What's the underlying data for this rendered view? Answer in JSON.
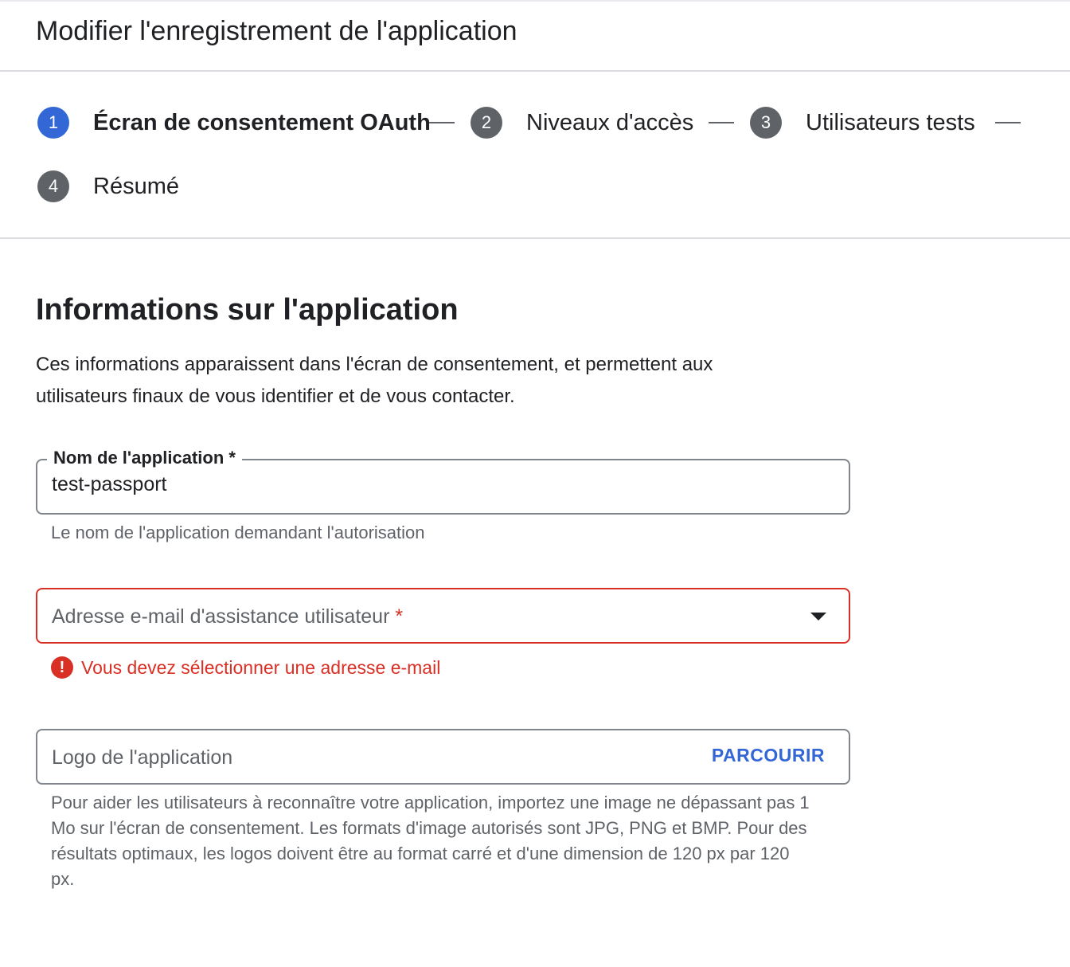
{
  "header": {
    "title": "Modifier l'enregistrement de l'application"
  },
  "stepper": {
    "steps": [
      {
        "number": "1",
        "label": "Écran de consentement OAuth",
        "active": true
      },
      {
        "number": "2",
        "label": "Niveaux d'accès",
        "active": false
      },
      {
        "number": "3",
        "label": "Utilisateurs tests",
        "active": false
      },
      {
        "number": "4",
        "label": "Résumé",
        "active": false
      }
    ]
  },
  "section": {
    "title": "Informations sur l'application",
    "description": "Ces informations apparaissent dans l'écran de consentement, et permettent aux utilisateurs finaux de vous identifier et de vous contacter."
  },
  "app_name": {
    "label": "Nom de l'application *",
    "value": "test-passport",
    "hint": "Le nom de l'application demandant l'autorisation"
  },
  "support_email": {
    "placeholder": "Adresse e-mail d'assistance utilisateur",
    "required_mark": "*",
    "error_icon": "!",
    "error": "Vous devez sélectionner une adresse e-mail"
  },
  "logo": {
    "placeholder": "Logo de l'application",
    "browse_label": "PARCOURIR",
    "hint": "Pour aider les utilisateurs à reconnaître votre application, importez une image ne dépassant pas 1 Mo sur l'écran de consentement. Les formats d'image autorisés sont JPG, PNG et BMP. Pour des résultats optimaux, les logos doivent être au format carré et d'une dimension de 120 px par 120 px."
  },
  "colors": {
    "accent": "#3367d6",
    "error": "#d93025",
    "step_inactive": "#5f6368"
  }
}
